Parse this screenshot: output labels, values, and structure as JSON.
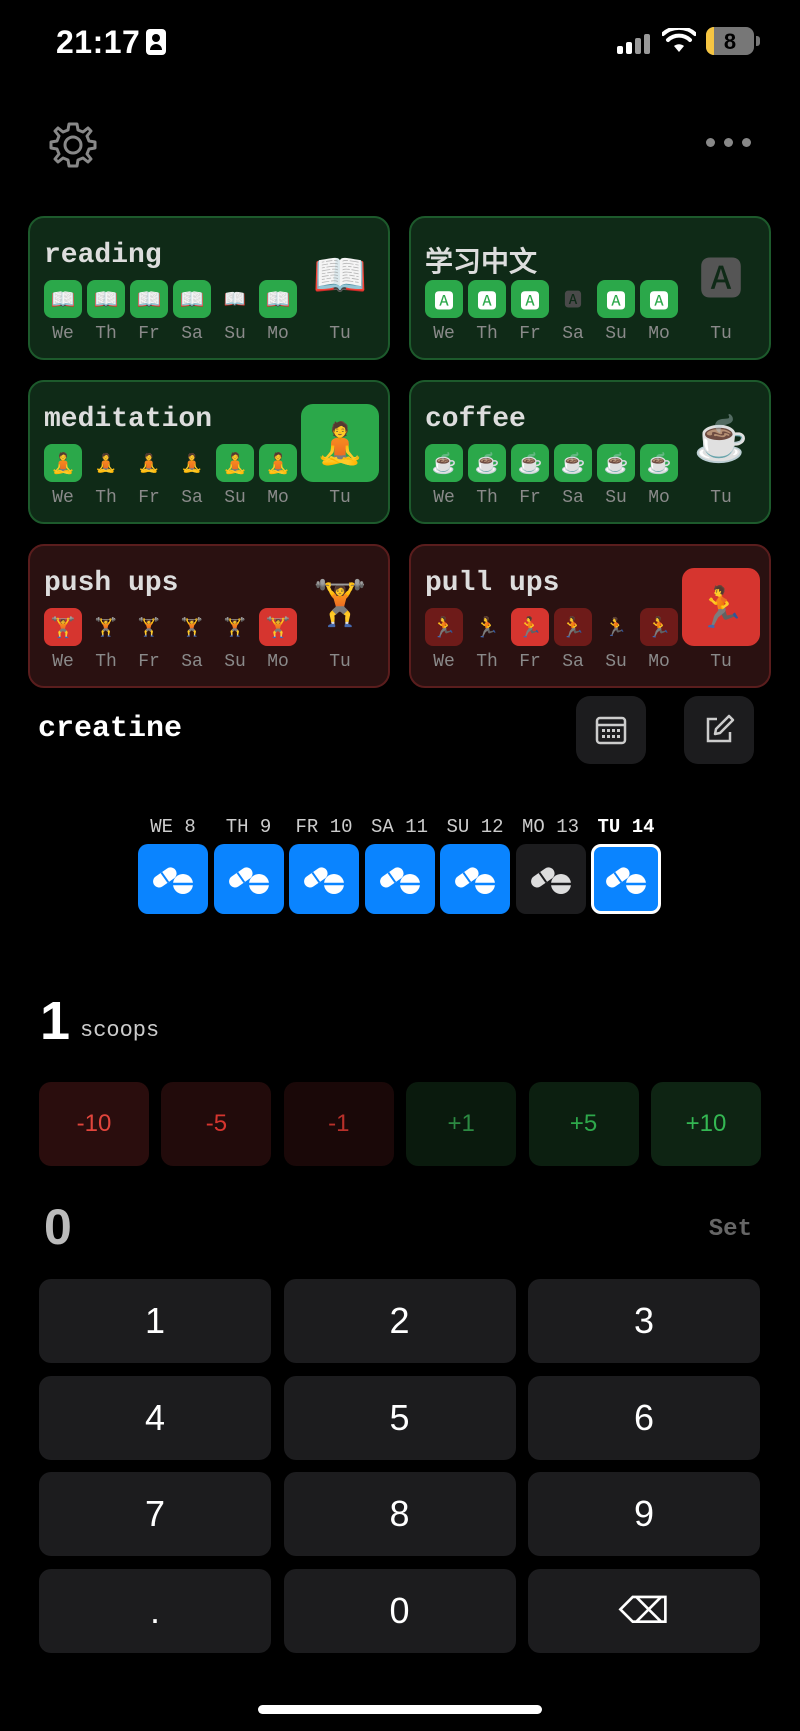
{
  "status": {
    "time": "21:17",
    "battery": "8"
  },
  "habits": [
    {
      "title": "reading",
      "color": "green",
      "icon": "📖",
      "days": [
        "We",
        "Th",
        "Fr",
        "Sa",
        "Su",
        "Mo"
      ],
      "today": "Tu",
      "states": [
        "on",
        "on",
        "on",
        "on",
        "off",
        "on"
      ],
      "today_state": "off"
    },
    {
      "title": "学习中文",
      "color": "green",
      "icon": "🅰",
      "days": [
        "We",
        "Th",
        "Fr",
        "Sa",
        "Su",
        "Mo"
      ],
      "today": "Tu",
      "states": [
        "on",
        "on",
        "on",
        "off",
        "on",
        "on"
      ],
      "today_state": "off"
    },
    {
      "title": "meditation",
      "color": "green",
      "icon": "🧘",
      "days": [
        "We",
        "Th",
        "Fr",
        "Sa",
        "Su",
        "Mo"
      ],
      "today": "Tu",
      "states": [
        "on",
        "off",
        "off",
        "off",
        "on",
        "on"
      ],
      "today_state": "on"
    },
    {
      "title": "coffee",
      "color": "green",
      "icon": "☕",
      "days": [
        "We",
        "Th",
        "Fr",
        "Sa",
        "Su",
        "Mo"
      ],
      "today": "Tu",
      "states": [
        "on",
        "on",
        "on",
        "on",
        "on",
        "on"
      ],
      "today_state": "off"
    },
    {
      "title": "push ups",
      "color": "red",
      "icon": "🏋",
      "days": [
        "We",
        "Th",
        "Fr",
        "Sa",
        "Su",
        "Mo"
      ],
      "today": "Tu",
      "states": [
        "on",
        "off",
        "off",
        "off",
        "off",
        "on"
      ],
      "today_state": "off"
    },
    {
      "title": "pull ups",
      "color": "red",
      "icon": "🏃",
      "days": [
        "We",
        "Th",
        "Fr",
        "Sa",
        "Su",
        "Mo"
      ],
      "today": "Tu",
      "states": [
        "half",
        "red",
        "on",
        "half",
        "off",
        "half"
      ],
      "today_state": "on"
    }
  ],
  "detail": {
    "title": "creatine",
    "week": [
      {
        "label": "WE 8",
        "state": "on"
      },
      {
        "label": "TH 9",
        "state": "on"
      },
      {
        "label": "FR 10",
        "state": "on"
      },
      {
        "label": "SA 11",
        "state": "on"
      },
      {
        "label": "SU 12",
        "state": "on"
      },
      {
        "label": "MO 13",
        "state": "off"
      },
      {
        "label": "TU 14",
        "state": "current"
      }
    ],
    "amount": "1",
    "unit": "scoops",
    "increments": [
      "-10",
      "-5",
      "-1",
      "+1",
      "+5",
      "+10"
    ],
    "entry": "0",
    "set_label": "Set",
    "keys": [
      "1",
      "2",
      "3",
      "4",
      "5",
      "6",
      "7",
      "8",
      "9",
      ".",
      "0",
      "⌫"
    ]
  },
  "colors": {
    "green": "#2ba84a",
    "red": "#d6352f",
    "blue": "#0a84ff"
  }
}
